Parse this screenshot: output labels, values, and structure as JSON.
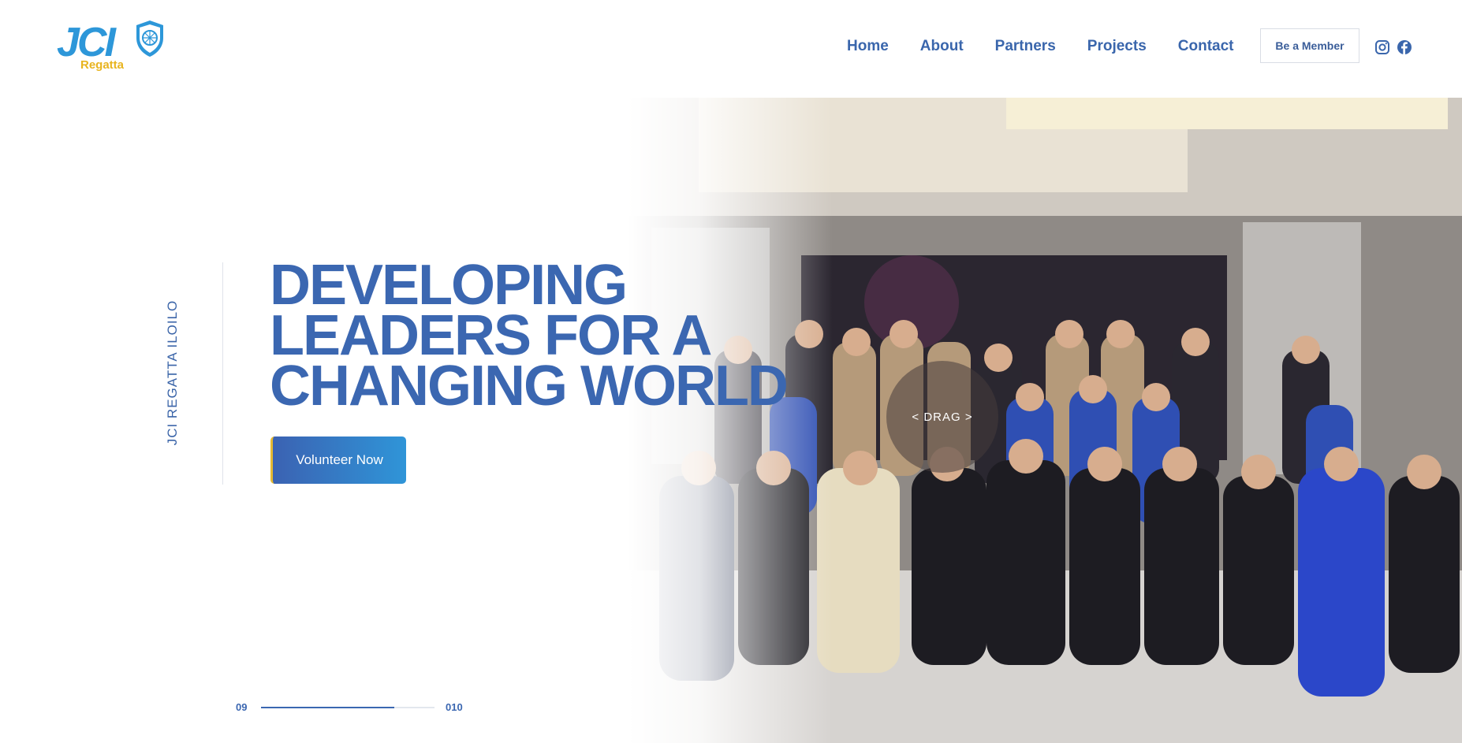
{
  "brand": {
    "logo_text": "JCI",
    "logo_sub": "Regatta"
  },
  "nav": {
    "items": [
      "Home",
      "About",
      "Partners",
      "Projects",
      "Contact"
    ]
  },
  "cta": {
    "member_label": "Be a Member"
  },
  "social": {
    "icons": [
      "instagram-icon",
      "facebook-icon"
    ]
  },
  "hero": {
    "side_label": "JCI REGATTA ILOILO",
    "headline_lines": [
      "DEVELOPING",
      "LEADERS FOR A",
      "CHANGING WORLD"
    ],
    "button_label": "Volunteer Now",
    "drag_label": "<  DRAG  >"
  },
  "pagination": {
    "current": "09",
    "total": "010",
    "progress": 0.77
  },
  "colors": {
    "primary": "#3b67b1",
    "accent_yellow": "#e8b41f",
    "logo_blue": "#2d97d9"
  }
}
